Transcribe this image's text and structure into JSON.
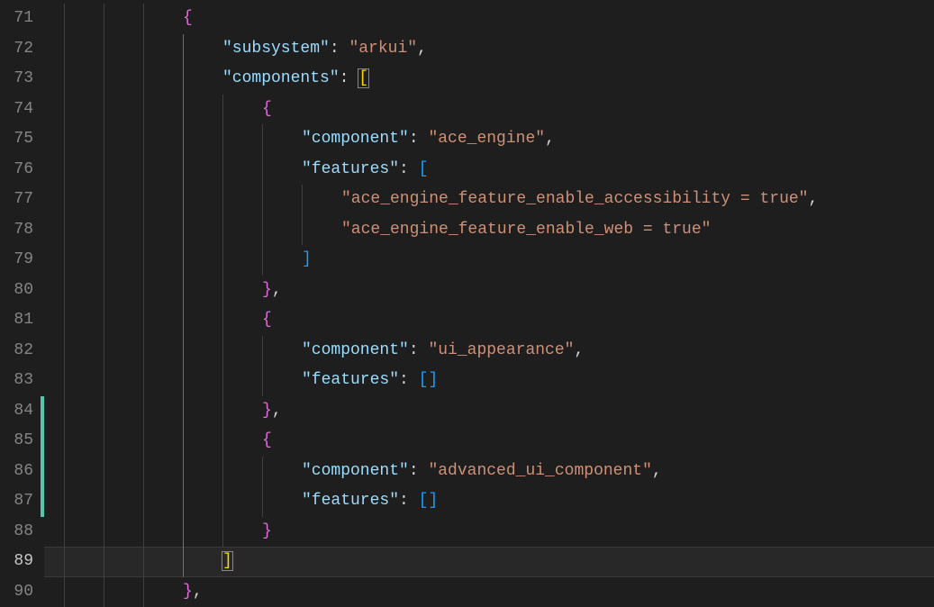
{
  "editor": {
    "startLine": 71,
    "activeLine": 89,
    "changedLines": [
      84,
      85,
      86,
      87
    ],
    "lines": [
      {
        "n": 71,
        "indent": 3,
        "tokens": [
          {
            "t": "brace",
            "v": "{"
          }
        ]
      },
      {
        "n": 72,
        "indent": 4,
        "tokens": [
          {
            "t": "key",
            "v": "\"subsystem\""
          },
          {
            "t": "punct",
            "v": ": "
          },
          {
            "t": "string",
            "v": "\"arkui\""
          },
          {
            "t": "punct",
            "v": ","
          }
        ]
      },
      {
        "n": 73,
        "indent": 4,
        "tokens": [
          {
            "t": "key",
            "v": "\"components\""
          },
          {
            "t": "punct",
            "v": ": "
          },
          {
            "t": "brace-yellow",
            "v": "[",
            "box": true
          }
        ]
      },
      {
        "n": 74,
        "indent": 5,
        "tokens": [
          {
            "t": "brace",
            "v": "{"
          }
        ]
      },
      {
        "n": 75,
        "indent": 6,
        "tokens": [
          {
            "t": "key",
            "v": "\"component\""
          },
          {
            "t": "punct",
            "v": ": "
          },
          {
            "t": "string",
            "v": "\"ace_engine\""
          },
          {
            "t": "punct",
            "v": ","
          }
        ]
      },
      {
        "n": 76,
        "indent": 6,
        "tokens": [
          {
            "t": "key",
            "v": "\"features\""
          },
          {
            "t": "punct",
            "v": ": "
          },
          {
            "t": "brace-blue",
            "v": "["
          }
        ]
      },
      {
        "n": 77,
        "indent": 7,
        "tokens": [
          {
            "t": "string",
            "v": "\"ace_engine_feature_enable_accessibility = true\""
          },
          {
            "t": "punct",
            "v": ","
          }
        ]
      },
      {
        "n": 78,
        "indent": 7,
        "tokens": [
          {
            "t": "string",
            "v": "\"ace_engine_feature_enable_web = true\""
          }
        ]
      },
      {
        "n": 79,
        "indent": 6,
        "tokens": [
          {
            "t": "brace-blue",
            "v": "]"
          }
        ]
      },
      {
        "n": 80,
        "indent": 5,
        "tokens": [
          {
            "t": "brace",
            "v": "}"
          },
          {
            "t": "punct",
            "v": ","
          }
        ]
      },
      {
        "n": 81,
        "indent": 5,
        "tokens": [
          {
            "t": "brace",
            "v": "{"
          }
        ]
      },
      {
        "n": 82,
        "indent": 6,
        "tokens": [
          {
            "t": "key",
            "v": "\"component\""
          },
          {
            "t": "punct",
            "v": ": "
          },
          {
            "t": "string",
            "v": "\"ui_appearance\""
          },
          {
            "t": "punct",
            "v": ","
          }
        ]
      },
      {
        "n": 83,
        "indent": 6,
        "tokens": [
          {
            "t": "key",
            "v": "\"features\""
          },
          {
            "t": "punct",
            "v": ": "
          },
          {
            "t": "brace-blue",
            "v": "["
          },
          {
            "t": "brace-blue",
            "v": "]"
          }
        ]
      },
      {
        "n": 84,
        "indent": 5,
        "tokens": [
          {
            "t": "brace",
            "v": "}"
          },
          {
            "t": "punct",
            "v": ","
          }
        ]
      },
      {
        "n": 85,
        "indent": 5,
        "tokens": [
          {
            "t": "brace",
            "v": "{"
          }
        ]
      },
      {
        "n": 86,
        "indent": 6,
        "tokens": [
          {
            "t": "key",
            "v": "\"component\""
          },
          {
            "t": "punct",
            "v": ": "
          },
          {
            "t": "string",
            "v": "\"advanced_ui_component\""
          },
          {
            "t": "punct",
            "v": ","
          }
        ]
      },
      {
        "n": 87,
        "indent": 6,
        "tokens": [
          {
            "t": "key",
            "v": "\"features\""
          },
          {
            "t": "punct",
            "v": ": "
          },
          {
            "t": "brace-blue",
            "v": "["
          },
          {
            "t": "brace-blue",
            "v": "]"
          }
        ]
      },
      {
        "n": 88,
        "indent": 5,
        "tokens": [
          {
            "t": "brace",
            "v": "}"
          }
        ]
      },
      {
        "n": 89,
        "indent": 4,
        "tokens": [
          {
            "t": "brace-yellow",
            "v": "]",
            "box": true
          }
        ]
      },
      {
        "n": 90,
        "indent": 3,
        "tokens": [
          {
            "t": "brace",
            "v": "}"
          },
          {
            "t": "punct",
            "v": ","
          }
        ]
      }
    ]
  },
  "chart_data": {
    "type": "table",
    "title": "JSON configuration snippet",
    "data": {
      "subsystem": "arkui",
      "components": [
        {
          "component": "ace_engine",
          "features": [
            "ace_engine_feature_enable_accessibility = true",
            "ace_engine_feature_enable_web = true"
          ]
        },
        {
          "component": "ui_appearance",
          "features": []
        },
        {
          "component": "advanced_ui_component",
          "features": []
        }
      ]
    }
  }
}
